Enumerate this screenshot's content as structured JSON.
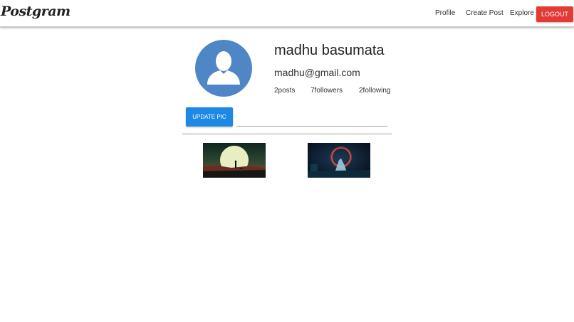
{
  "navbar": {
    "brand": "Postgram",
    "links": [
      {
        "label": "Profile"
      },
      {
        "label": "Create Post"
      },
      {
        "label": "Explore"
      }
    ],
    "logout_label": "LOGOUT",
    "logout_color": "#e53935"
  },
  "profile": {
    "avatar_icon": "user-silhouette-icon",
    "avatar_color": "#4f86c6",
    "name": "madhu basumata",
    "email": "madhu@gmail.com",
    "stats": {
      "posts": "2posts",
      "followers": "7followers",
      "following": "2following"
    },
    "update_pic_label": "UPDATE PIC",
    "update_pic_color": "#1e88e5",
    "file_path_value": ""
  },
  "gallery": {
    "items": [
      {
        "image": "sunset-silhouette-photo"
      },
      {
        "image": "neon-ring-photo"
      }
    ]
  }
}
